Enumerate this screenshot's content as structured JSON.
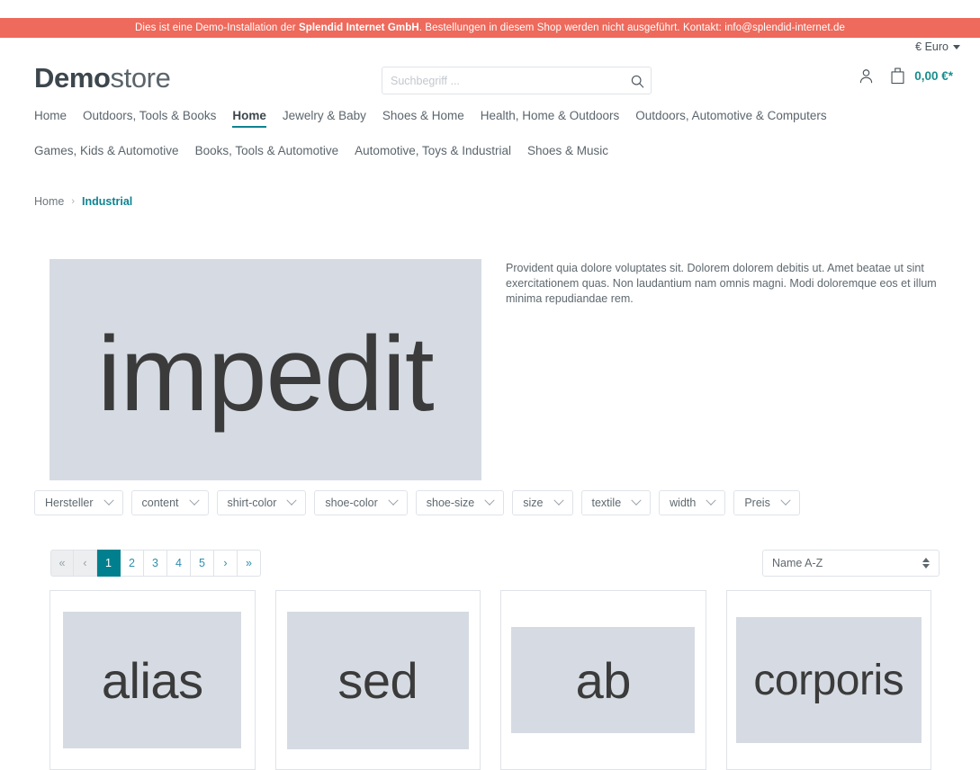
{
  "banner": {
    "prefix": "Dies ist eine Demo-Installation der ",
    "company": "Splendid Internet GmbH",
    "middle": ". Bestellungen in diesem Shop werden nicht ausgeführt. Kontakt: ",
    "email": "info@splendid-internet.de",
    "bg_color": "#ed6a5c"
  },
  "topbar": {
    "currency": "€ Euro"
  },
  "header": {
    "logo_bold": "Demo",
    "logo_light": "store",
    "search": {
      "placeholder": "Suchbegriff ...",
      "value": ""
    },
    "account_icon": "user-icon",
    "cart_icon": "bag-icon",
    "cart_total": "0,00 €*",
    "cart_total_color": "#1a8d8d"
  },
  "nav": {
    "row1": [
      {
        "label": "Home",
        "active": false
      },
      {
        "label": "Outdoors, Tools & Books",
        "active": false
      },
      {
        "label": "Home",
        "active": true
      },
      {
        "label": "Jewelry & Baby",
        "active": false
      },
      {
        "label": "Shoes & Home",
        "active": false
      },
      {
        "label": "Health, Home & Outdoors",
        "active": false
      },
      {
        "label": "Outdoors, Automotive & Computers",
        "active": false
      }
    ],
    "row2": [
      {
        "label": "Games, Kids & Automotive",
        "active": false
      },
      {
        "label": "Books, Tools & Automotive",
        "active": false
      },
      {
        "label": "Automotive, Toys & Industrial",
        "active": false
      },
      {
        "label": "Shoes & Music",
        "active": false
      }
    ],
    "accent_color": "#0e8391"
  },
  "breadcrumb": {
    "home": "Home",
    "separator": "›",
    "current": "Industrial"
  },
  "category": {
    "hero_text": "impedit",
    "hero_bg": "#d6dbe3",
    "description": "Provident quia dolore voluptates sit. Dolorem dolorem debitis ut. Amet beatae ut sint exercitationem quas. Non laudantium nam omnis magni. Modi doloremque eos et illum minima repudiandae rem."
  },
  "filters": [
    {
      "label": "Hersteller"
    },
    {
      "label": "content"
    },
    {
      "label": "shirt-color"
    },
    {
      "label": "shoe-color"
    },
    {
      "label": "shoe-size"
    },
    {
      "label": "size"
    },
    {
      "label": "textile"
    },
    {
      "label": "width"
    },
    {
      "label": "Preis"
    }
  ],
  "pagination": {
    "items": [
      {
        "label": "«",
        "type": "first",
        "state": "muted"
      },
      {
        "label": "‹",
        "type": "prev",
        "state": "muted"
      },
      {
        "label": "1",
        "type": "page",
        "state": "current"
      },
      {
        "label": "2",
        "type": "page",
        "state": "normal"
      },
      {
        "label": "3",
        "type": "page",
        "state": "normal"
      },
      {
        "label": "4",
        "type": "page",
        "state": "normal"
      },
      {
        "label": "5",
        "type": "page",
        "state": "normal"
      },
      {
        "label": "›",
        "type": "next",
        "state": "normal"
      },
      {
        "label": "»",
        "type": "last",
        "state": "normal"
      }
    ],
    "active_color": "#00808e"
  },
  "sorting": {
    "selected": "Name A-Z"
  },
  "products": [
    {
      "name": "alias",
      "thumb_w": 198,
      "thumb_h": 152,
      "font_size": 56
    },
    {
      "name": "sed",
      "thumb_w": 202,
      "thumb_h": 153,
      "font_size": 56
    },
    {
      "name": "ab",
      "thumb_w": 204,
      "thumb_h": 118,
      "font_size": 56
    },
    {
      "name": "corporis",
      "thumb_w": 206,
      "thumb_h": 140,
      "font_size": 48
    }
  ]
}
